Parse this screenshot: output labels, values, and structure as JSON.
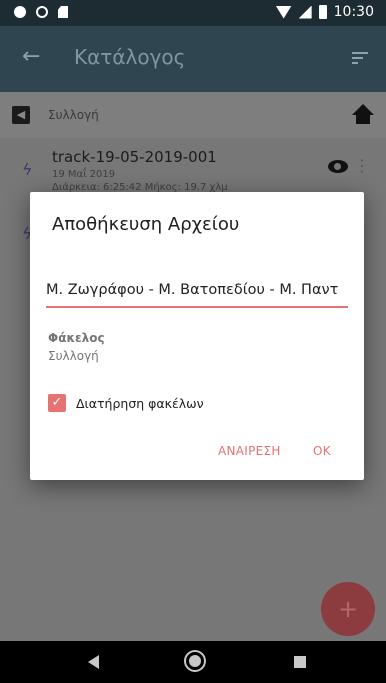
{
  "status_bar": {
    "time": "10:30"
  },
  "app_bar": {
    "back": "←",
    "title": "Κατάλογος"
  },
  "breadcrumb": {
    "back_glyph": "◀",
    "label": "Συλλογή"
  },
  "track": {
    "name": "track-19-05-2019-001",
    "date": "19 Μαΐ 2019",
    "meta": "Διάρκεια: 6:25:42    Μήκος: 19.7 χλμ",
    "route_glyph": "ϟ",
    "more_glyph": "⋮"
  },
  "fab": {
    "label": "+"
  },
  "dialog": {
    "title": "Αποθήκευση Αρχείου",
    "filename_value": "Μ. Ζωγράφου - Μ. Βατοπεδίου - Μ. Παντ",
    "folder_label": "Φάκελος",
    "folder_value": "Συλλογή",
    "checkbox_checked": true,
    "checkbox_glyph": "✓",
    "checkbox_label": "Διατήρηση φακέλων",
    "cancel_label": "ΑΝΑΙΡΕΣΗ",
    "ok_label": "OK"
  },
  "colors": {
    "accent": "#e57373",
    "app_bar": "#2f4550",
    "status_bar": "#1d2c33"
  }
}
